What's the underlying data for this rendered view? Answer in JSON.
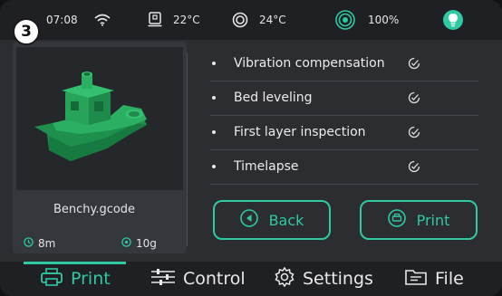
{
  "screen_number": "3",
  "status": {
    "time": "07:08",
    "bed_temp": "22°C",
    "nozzle_temp": "24°C",
    "speed": "100%"
  },
  "file": {
    "name": "Benchy.gcode",
    "time": "8m",
    "weight": "10g"
  },
  "options": [
    {
      "label": "Vibration compensation"
    },
    {
      "label": "Bed leveling"
    },
    {
      "label": "First layer inspection"
    },
    {
      "label": "Timelapse"
    }
  ],
  "buttons": {
    "back": "Back",
    "print": "Print"
  },
  "nav": {
    "print": "Print",
    "control": "Control",
    "settings": "Settings",
    "file": "File"
  },
  "colors": {
    "accent": "#2fc9a4",
    "background": "#2b2d31",
    "bar": "#1f2023"
  }
}
